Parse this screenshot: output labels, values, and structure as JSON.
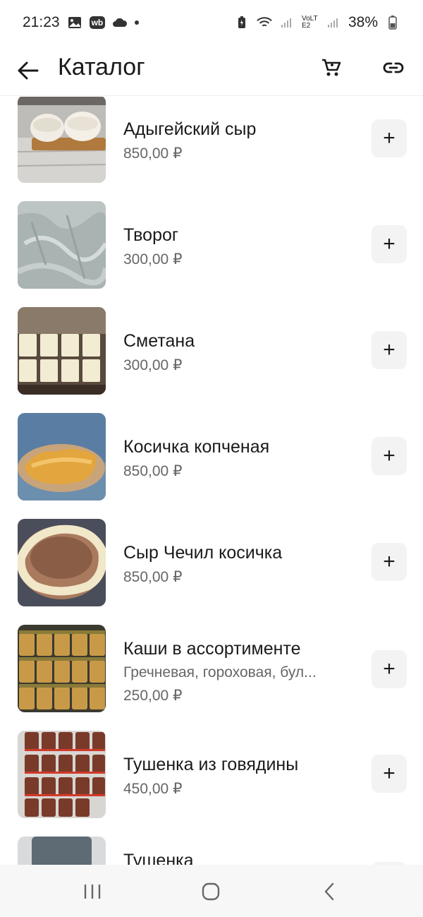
{
  "status_bar": {
    "time": "21:23",
    "battery_percent": "38%",
    "left_icons": [
      "gallery-icon",
      "wb-app-icon",
      "cloud-icon",
      "dot-icon"
    ],
    "right_icons": [
      "battery-saver-icon",
      "wifi-icon",
      "signal-icon",
      "volte-icon",
      "signal-icon",
      "battery-icon"
    ],
    "volte_label": "VoLTE2",
    "wb_label": "wb"
  },
  "app_bar": {
    "title": "Каталог",
    "back_icon": "arrow-left-icon",
    "cart_icon": "shopping-cart-icon",
    "link_icon": "link-icon"
  },
  "items": [
    {
      "name": "Адыгейский сыр",
      "description": "",
      "price": "850,00 ₽"
    },
    {
      "name": "Творог",
      "description": "",
      "price": "300,00 ₽"
    },
    {
      "name": "Сметана",
      "description": "",
      "price": "300,00 ₽"
    },
    {
      "name": "Косичка копченая",
      "description": "",
      "price": "850,00 ₽"
    },
    {
      "name": "Сыр Чечил косичка",
      "description": "",
      "price": "850,00 ₽"
    },
    {
      "name": "Каши в ассортименте",
      "description": "Гречневая, гороховая, бул...",
      "price": "250,00 ₽"
    },
    {
      "name": "Тушенка из говядины",
      "description": "",
      "price": "450,00 ₽"
    },
    {
      "name": "Тушенка",
      "description": "",
      "price": ""
    }
  ],
  "add_label": "+",
  "nav_bar": {
    "icons": [
      "recent-apps-icon",
      "home-icon",
      "back-nav-icon"
    ]
  },
  "colors": {
    "background": "#ffffff",
    "text_primary": "#1a1a1a",
    "text_secondary": "#666666",
    "add_button_bg": "#f3f3f3",
    "nav_bg": "#f7f7f7"
  }
}
